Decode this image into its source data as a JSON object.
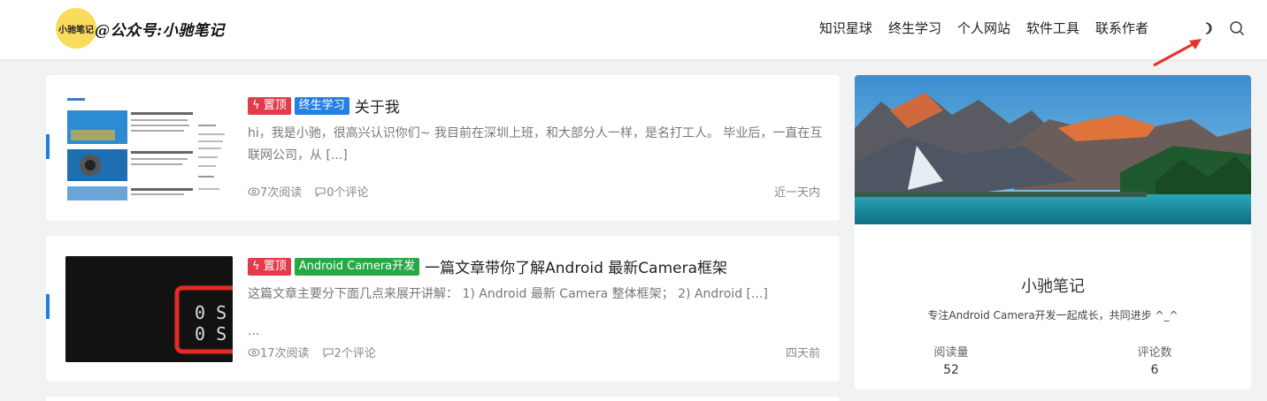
{
  "header": {
    "logo_badge": "小驰笔记",
    "logo_text": "@公众号:小驰笔记",
    "nav": [
      "知识星球",
      "终生学习",
      "个人网站",
      "软件工具",
      "联系作者"
    ]
  },
  "posts": [
    {
      "badges": [
        "置顶",
        "终生学习"
      ],
      "title": "关于我",
      "excerpt": "hi，我是小驰，很高兴认识你们~ 我目前在深圳上班，和大部分人一样，是名打工人。 毕业后，一直在互联网公司，从 [...]",
      "reads": "7次阅读",
      "comments": "0个评论",
      "date": "近一天内"
    },
    {
      "badges": [
        "置顶",
        "Android Camera开发"
      ],
      "title": "一篇文章带你了解Android 最新Camera框架",
      "excerpt": "这篇文章主要分下面几点来展开讲解： 1) Android 最新 Camera 整体框架； 2) Android [...]",
      "excerpt2": "...",
      "reads": "17次阅读",
      "comments": "2个评论",
      "date": "四天前",
      "thumb_text": "0 S"
    }
  ],
  "sidebar": {
    "name": "小驰笔记",
    "desc": "专注Android Camera开发一起成长，共同进步 ^_^",
    "stats": [
      {
        "label": "阅读量",
        "value": "52"
      },
      {
        "label": "评论数",
        "value": "6"
      }
    ]
  },
  "colors": {
    "accent": "#1e7ee6",
    "badge_red": "#e23c4b",
    "badge_blue": "#2580e6",
    "badge_green": "#27a844",
    "logo_yellow": "#f9dc5c"
  }
}
